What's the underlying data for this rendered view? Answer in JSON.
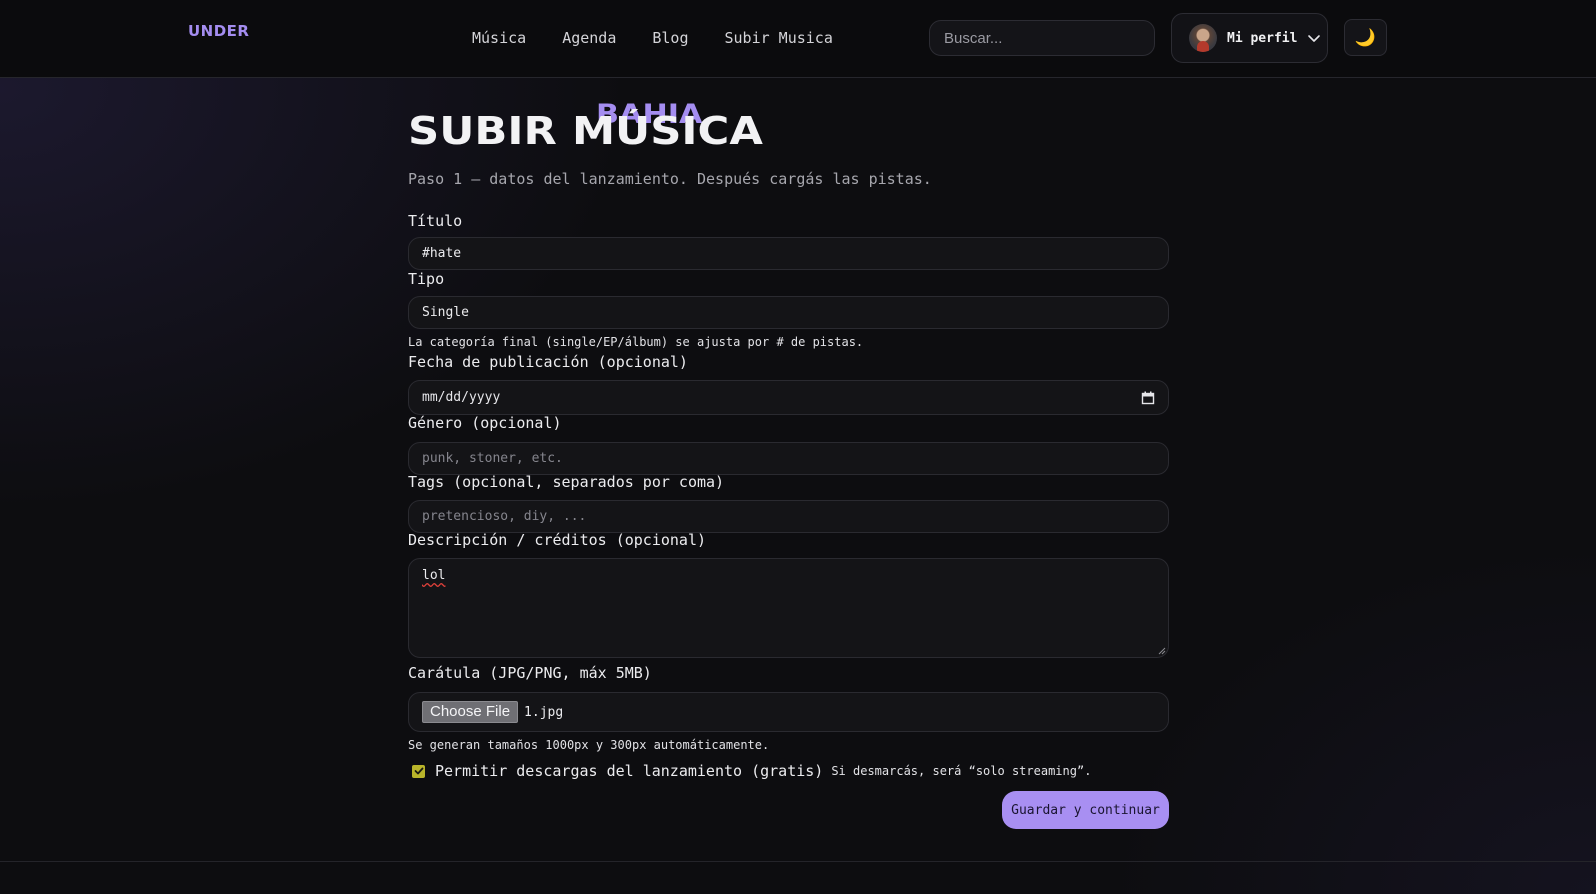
{
  "header": {
    "logo_main": "BAHIA",
    "logo_sup": "UNDER",
    "nav": [
      "Música",
      "Agenda",
      "Blog",
      "Subir Musica"
    ],
    "search_placeholder": "Buscar...",
    "profile_label": "Mi perfil",
    "theme_icon": "🌙"
  },
  "page": {
    "title": "SUBIR MÚSICA",
    "subtitle": "Paso 1 — datos del lanzamiento. Después cargás las pistas."
  },
  "form": {
    "titulo": {
      "label": "Título",
      "value": "#hate"
    },
    "tipo": {
      "label": "Tipo",
      "value": "Single",
      "help": "La categoría final (single/EP/álbum) se ajusta por # de pistas."
    },
    "fecha": {
      "label": "Fecha de publicación (opcional)",
      "value": "mm/dd/yyyy"
    },
    "genero": {
      "label": "Género (opcional)",
      "placeholder": "punk, stoner, etc."
    },
    "tags": {
      "label": "Tags (opcional, separados por coma)",
      "placeholder": "pretencioso, diy, ..."
    },
    "descripcion": {
      "label": "Descripción / créditos (opcional)",
      "value": "lol"
    },
    "caratula": {
      "label": "Carátula (JPG/PNG, máx 5MB)",
      "button": "Choose File",
      "file": "1.jpg",
      "help": "Se generan tamaños 1000px y 300px automáticamente."
    },
    "descargas": {
      "checked": true,
      "label": "Permitir descargas del lanzamiento (gratis)",
      "help": "Si desmarcás, será “solo streaming”."
    },
    "submit": "Guardar y continuar"
  },
  "colors": {
    "accent": "#a88ff2",
    "logo": "#a48df0",
    "checkbox": "#b9b42a"
  }
}
